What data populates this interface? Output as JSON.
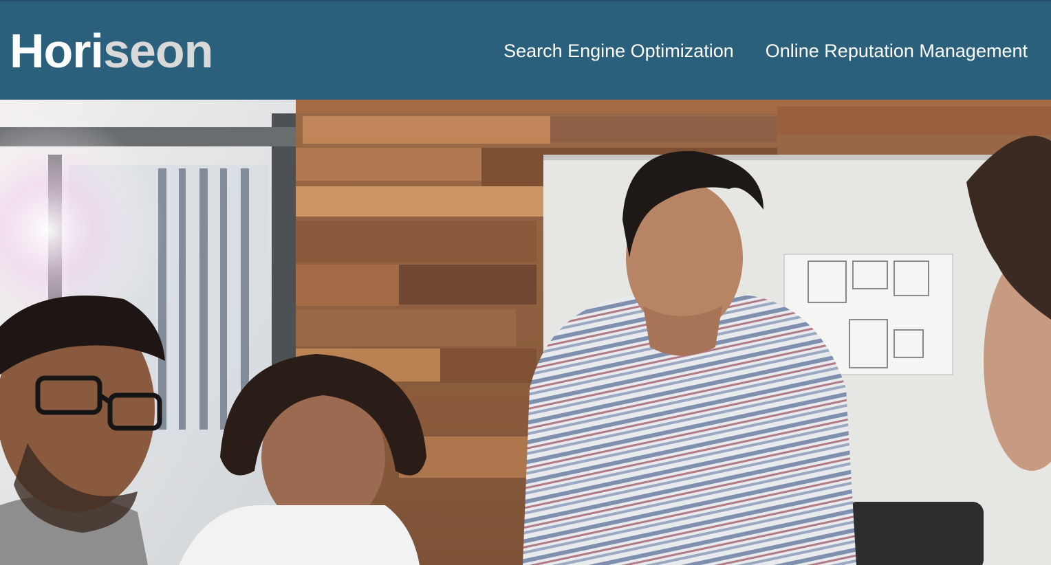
{
  "header": {
    "logo_prefix": "Hori",
    "logo_accent": "seon",
    "nav": [
      {
        "label": "Search Engine Optimization"
      },
      {
        "label": "Online Reputation Management"
      }
    ]
  },
  "colors": {
    "header_bg": "#2a607c",
    "logo_accent": "#d9d9d9",
    "text": "#ffffff"
  },
  "hero": {
    "icon": "team-meeting-photo"
  }
}
